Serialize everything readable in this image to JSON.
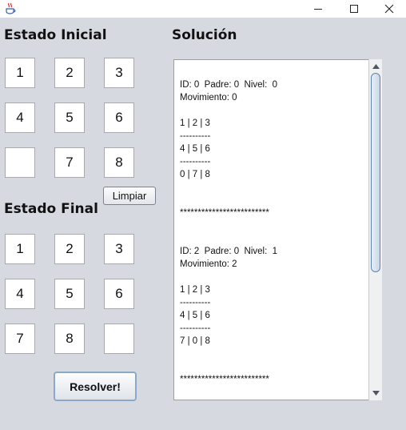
{
  "window": {
    "icon": "java-coffee-cup-icon",
    "controls": {
      "minimize": "minimize-icon",
      "maximize": "maximize-icon",
      "close": "close-icon"
    }
  },
  "initial_state": {
    "title": "Estado Inicial",
    "cells": [
      "1",
      "2",
      "3",
      "4",
      "5",
      "6",
      "",
      "7",
      "8"
    ]
  },
  "final_state": {
    "title": "Estado Final",
    "cells": [
      "1",
      "2",
      "3",
      "4",
      "5",
      "6",
      "7",
      "8",
      ""
    ]
  },
  "buttons": {
    "clear_label": "Limpiar",
    "solve_label": "Resolver!"
  },
  "solution": {
    "title": "Solución",
    "text": "ID: 0  Padre: 0  Nivel:  0\nMovimiento: 0\n\n1 | 2 | 3\n----------\n4 | 5 | 6\n----------\n0 | 7 | 8\n\n\n*************************\n\n\nID: 2  Padre: 0  Nivel:  1\nMovimiento: 2\n\n1 | 2 | 3\n----------\n4 | 5 | 6\n----------\n7 | 0 | 8\n\n\n*************************"
  },
  "colors": {
    "background": "#d6d9df",
    "scroll_thumb_border": "#5d84b0"
  }
}
